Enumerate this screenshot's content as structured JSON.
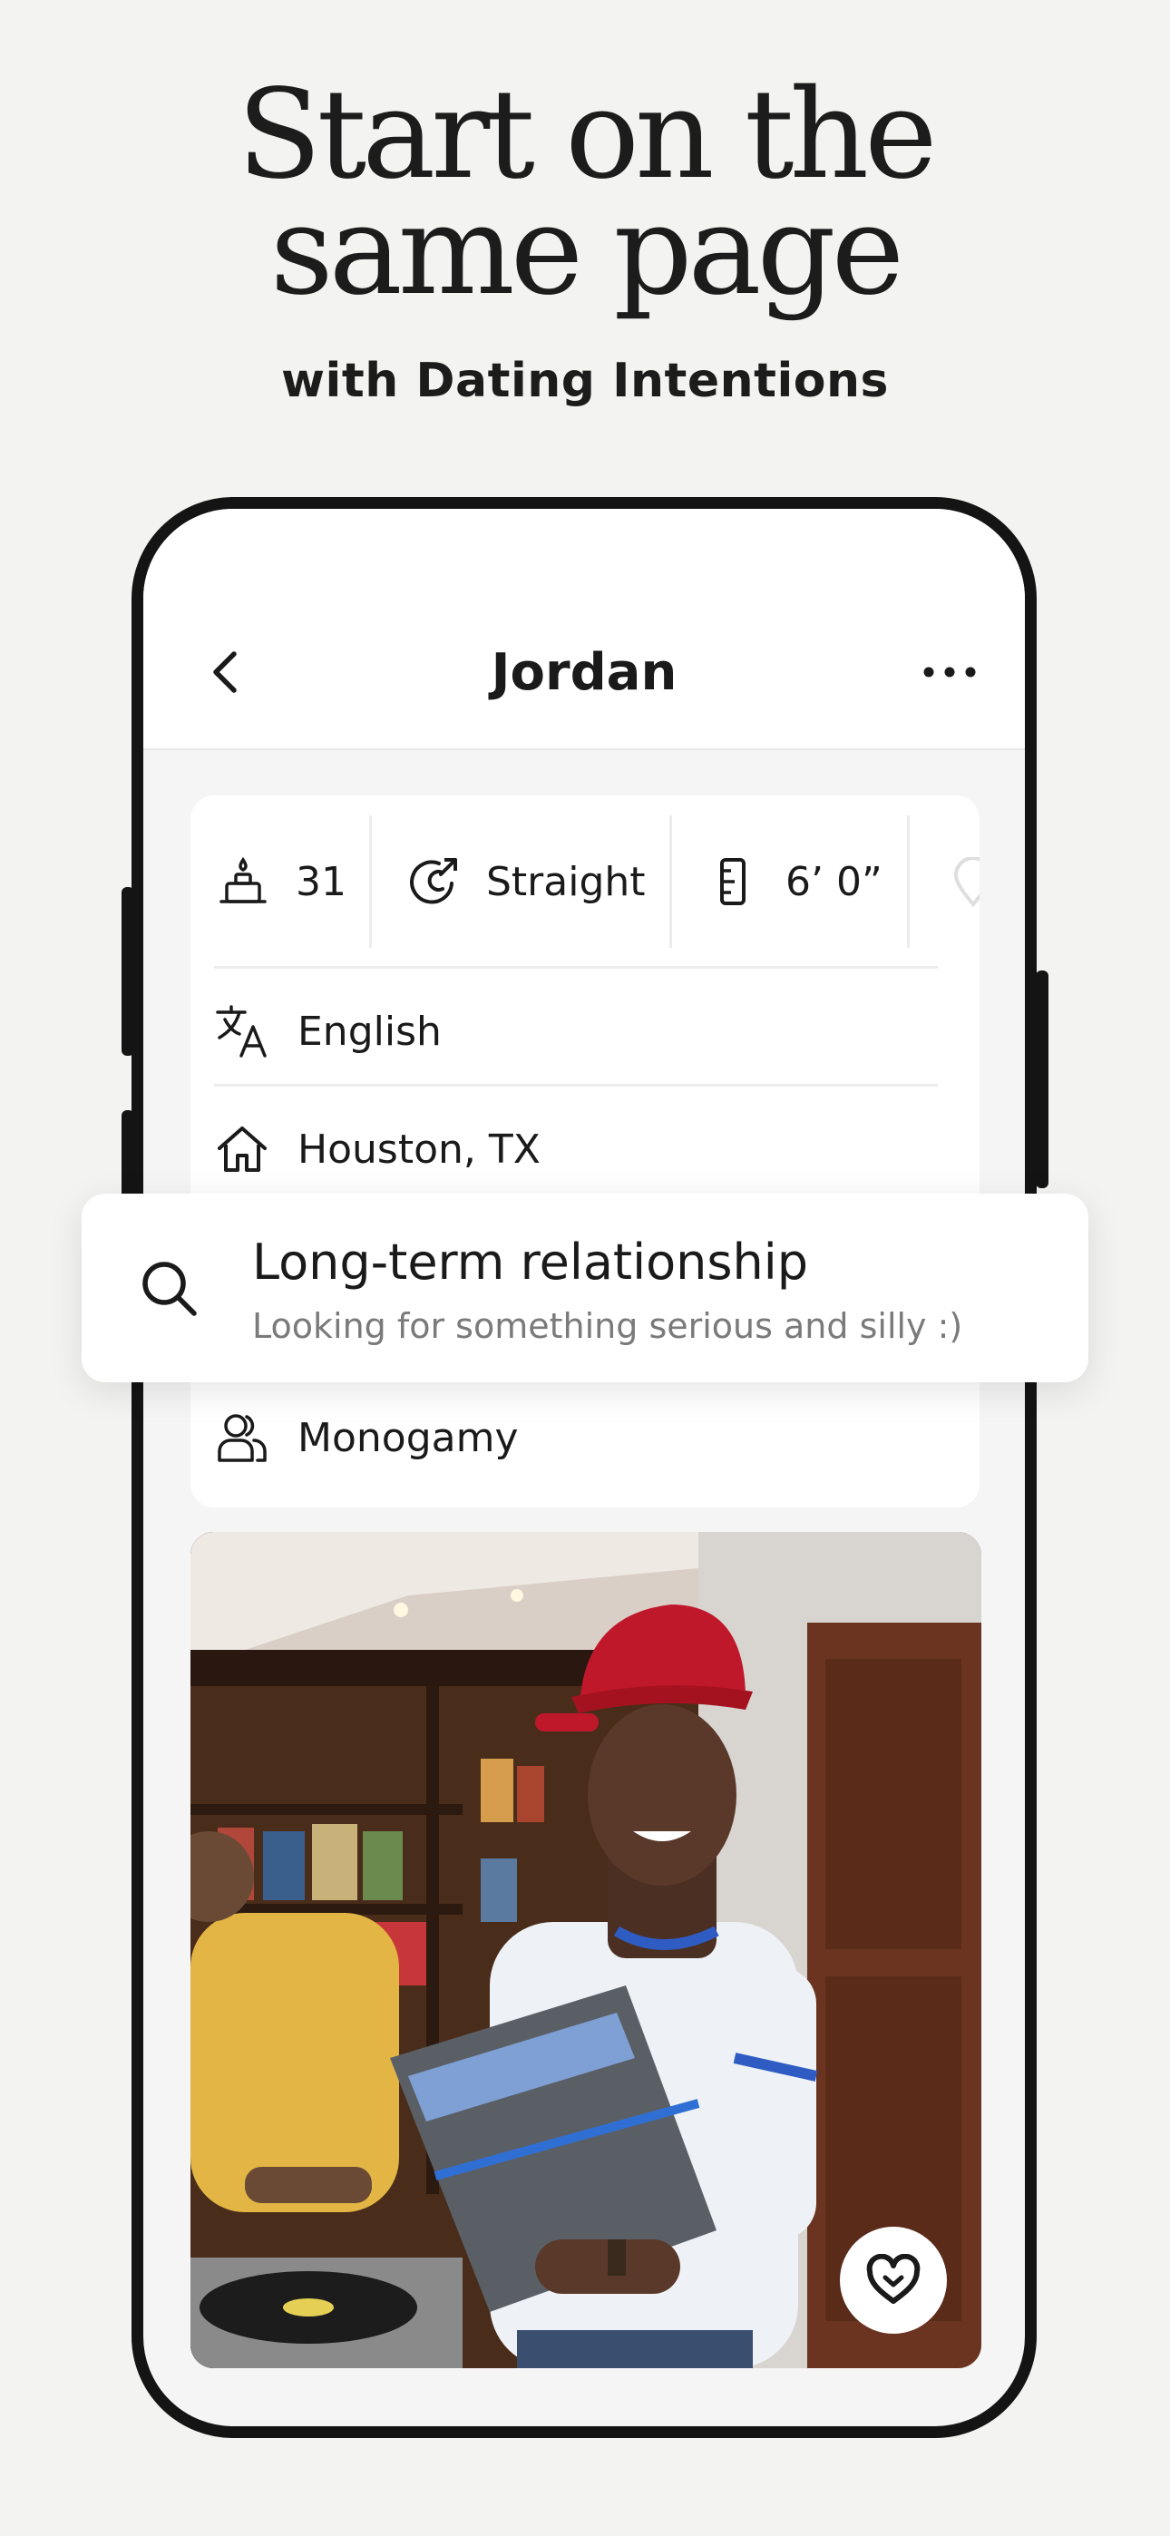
{
  "headline": {
    "line1": "Start on the",
    "line2": "same page"
  },
  "subhead": "with Dating Intentions",
  "profile": {
    "name": "Jordan",
    "vitals": [
      {
        "icon": "cake-icon",
        "value": "31"
      },
      {
        "icon": "sexuality-icon",
        "value": "Straight"
      },
      {
        "icon": "ruler-icon",
        "value": "6’ 0”"
      }
    ],
    "language": {
      "icon": "translate-icon",
      "value": "English"
    },
    "location": {
      "icon": "home-icon",
      "value": "Houston, TX"
    },
    "relationship_type": {
      "icon": "people-icon",
      "value": "Monogamy"
    }
  },
  "intention_popup": {
    "icon": "search-icon",
    "title": "Long-term relationship",
    "subtitle": "Looking for something serious and silly :)"
  },
  "colors": {
    "background": "#f3f4f1",
    "phone_frame": "#141414",
    "text": "#1a1a1a",
    "muted": "#7a7a7a"
  }
}
